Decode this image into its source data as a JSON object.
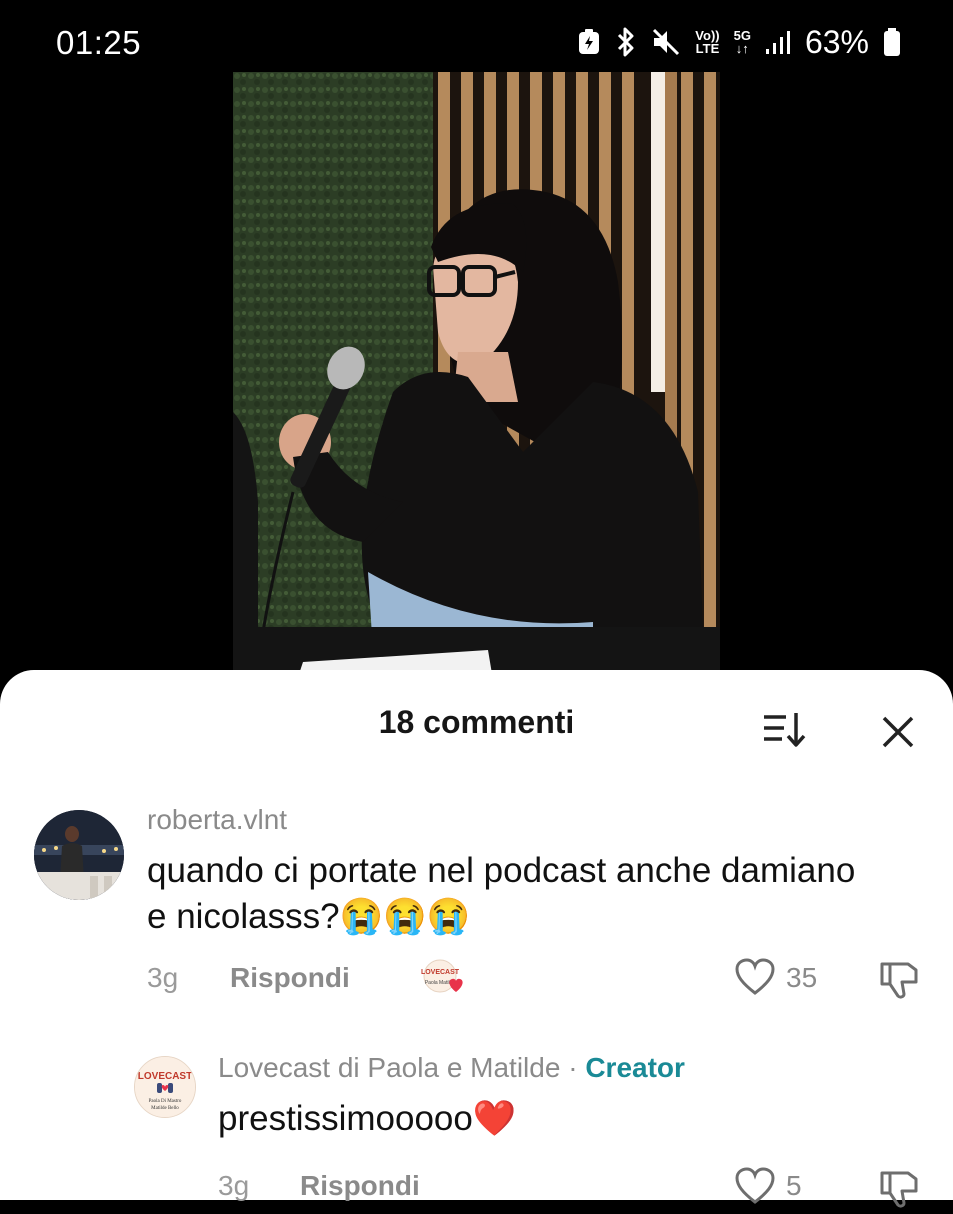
{
  "status_bar": {
    "time": "01:25",
    "network_top": "Vo))",
    "network_bottom": "LTE",
    "gen": "5G",
    "battery": "63%",
    "icons": [
      "battery-saver-icon",
      "bluetooth-icon",
      "mute-icon",
      "volte-icon",
      "5g-icon",
      "signal-icon",
      "battery-icon"
    ]
  },
  "video": {
    "description_icon": "video-frame"
  },
  "comments": {
    "title": "18 commenti",
    "sort_icon": "sort-icon",
    "close_icon": "close-icon",
    "items": [
      {
        "username": "roberta.vlnt",
        "text": "quando ci portate nel podcast anche damiano e nicolasss?😭😭😭",
        "time": "3g",
        "reply_label": "Rispondi",
        "likes": "35",
        "liked_by_creator": true
      }
    ],
    "replies": [
      {
        "username": "Lovecast di Paola e Matilde",
        "separator": " · ",
        "badge": "Creator",
        "text": "prestissimooooo❤️",
        "time": "3g",
        "reply_label": "Rispondi",
        "likes": "5",
        "avatar_text": "LOVECAST"
      }
    ]
  },
  "colors": {
    "creator_badge": "#1a8a96",
    "muted_text": "#8a8a8a",
    "heart": "#e8334a"
  }
}
